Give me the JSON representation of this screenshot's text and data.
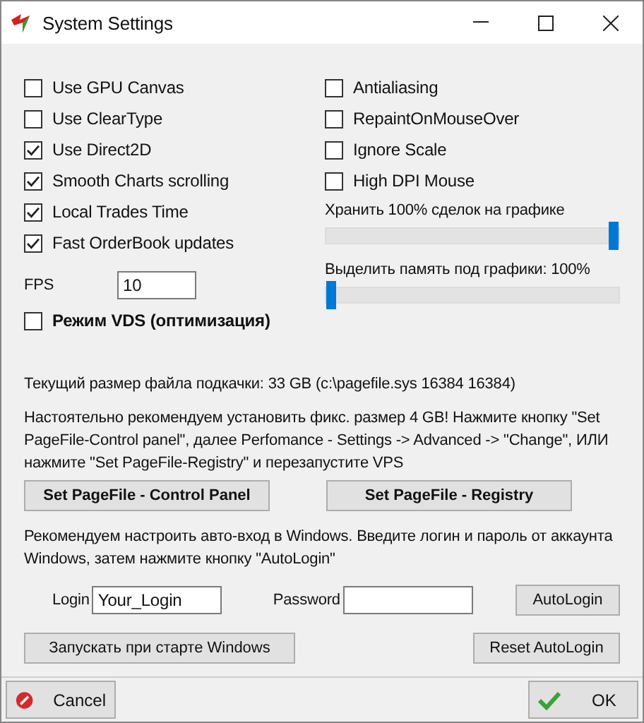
{
  "window": {
    "title": "System Settings"
  },
  "left_options": [
    {
      "label": "Use GPU Canvas",
      "checked": false
    },
    {
      "label": "Use ClearType",
      "checked": false
    },
    {
      "label": "Use Direct2D",
      "checked": true
    },
    {
      "label": "Smooth Charts scrolling",
      "checked": true
    },
    {
      "label": "Local Trades Time",
      "checked": true
    },
    {
      "label": "Fast OrderBook updates",
      "checked": true
    }
  ],
  "fps": {
    "label": "FPS",
    "value": "10"
  },
  "vds_mode": {
    "label": "Режим VDS (оптимизация)",
    "checked": false
  },
  "right_options": [
    {
      "label": "Antialiasing",
      "checked": false
    },
    {
      "label": "RepaintOnMouseOver",
      "checked": false
    },
    {
      "label": "Ignore Scale",
      "checked": false
    },
    {
      "label": "High DPI Mouse",
      "checked": false
    }
  ],
  "sliders": [
    {
      "label": "Хранить 100% сделок на графике",
      "level": 1
    },
    {
      "label": "Выделить память под графики: 100%",
      "level": 0
    }
  ],
  "pagefile_info": "Текущий размер файла подкачки: 33 GB (c:\\pagefile.sys 16384 16384)",
  "pagefile_advice": "Настоятельно рекомендуем установить фикс. размер 4 GB! Нажмите кнопку \"Set PageFile-Control panel\", далее Perfomance - Settings -> Advanced -> \"Change\", ИЛИ нажмите \"Set PageFile-Registry\" и перезапустите VPS",
  "pagefile_buttons": [
    "Set PageFile - Control Panel",
    "Set PageFile - Registry"
  ],
  "autologin_advice": "Рекомендуем настроить авто-вход в Windows. Введите логин и пароль от аккаунта Windows, затем нажмите кнопку \"AutoLogin\"",
  "login": {
    "label": "Login",
    "value": "Your_Login"
  },
  "password": {
    "label": "Password"
  },
  "autologin_button": "AutoLogin",
  "startup_button": "Запускать при старте Windows",
  "reset_autologin_button": "Reset AutoLogin",
  "footer": {
    "cancel": "Cancel",
    "ok": "OK"
  }
}
